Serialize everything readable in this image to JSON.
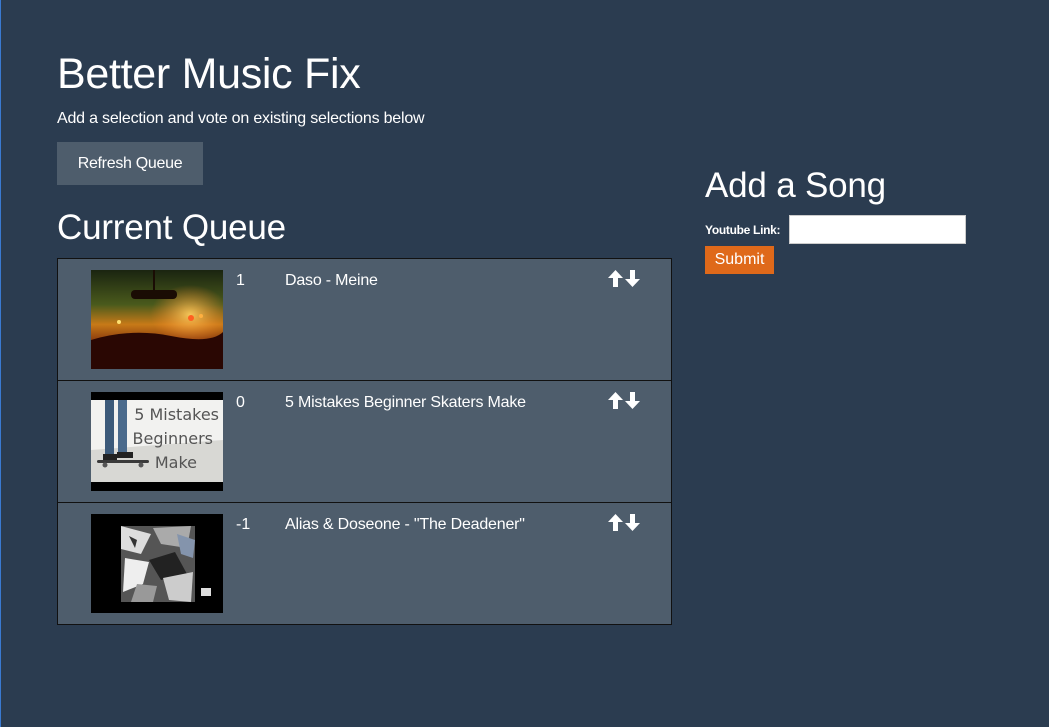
{
  "header": {
    "title": "Better Music Fix",
    "subtitle": "Add a selection and vote on existing selections below",
    "refresh_label": "Refresh Queue"
  },
  "queue": {
    "heading": "Current Queue",
    "songs": [
      {
        "votes": "1",
        "title": "Daso - Meine",
        "thumbnail": "car-interior-at-night"
      },
      {
        "votes": "0",
        "title": "5 Mistakes Beginner Skaters Make",
        "thumbnail": "skateboarder-with-text"
      },
      {
        "votes": "-1",
        "title": "Alias & Doseone - \"The Deadener\"",
        "thumbnail": "abstract-black-and-white-art"
      }
    ]
  },
  "add_song": {
    "heading": "Add a Song",
    "link_label": "Youtube Link:",
    "link_value": "",
    "submit_label": "Submit",
    "thumb_text_lines": [
      "5 Mistakes",
      "Beginners",
      "Make"
    ]
  },
  "colors": {
    "background": "#2b3c50",
    "panel": "#4e5d6c",
    "accent": "#df691a"
  }
}
